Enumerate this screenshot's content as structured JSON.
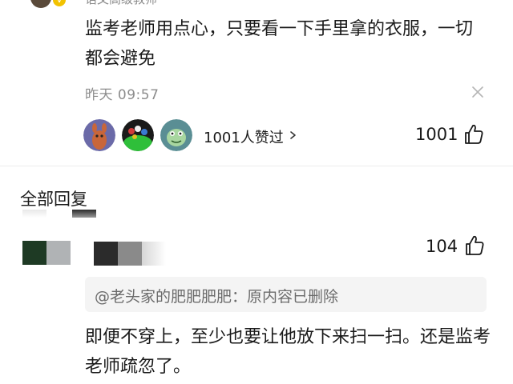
{
  "author": {
    "title": "语文高级教师",
    "badge": "V"
  },
  "comment": {
    "text": "监考老师用点心，只要看一下手里拿的衣服，一切都会避免",
    "time": "昨天  09:57"
  },
  "likers": {
    "label": "1001人赞过",
    "total": "1001"
  },
  "replies_section": {
    "title": "全部回复"
  },
  "reply": {
    "like_count": "104",
    "quote": "@老头家的肥肥肥肥：原内容已删除",
    "text": "即便不穿上，至少也要让他放下来扫一扫。还是监考老师疏忽了。"
  },
  "icons": {
    "close": "close-icon",
    "chevron": "chevron-right-icon",
    "like": "thumbs-up-icon"
  }
}
